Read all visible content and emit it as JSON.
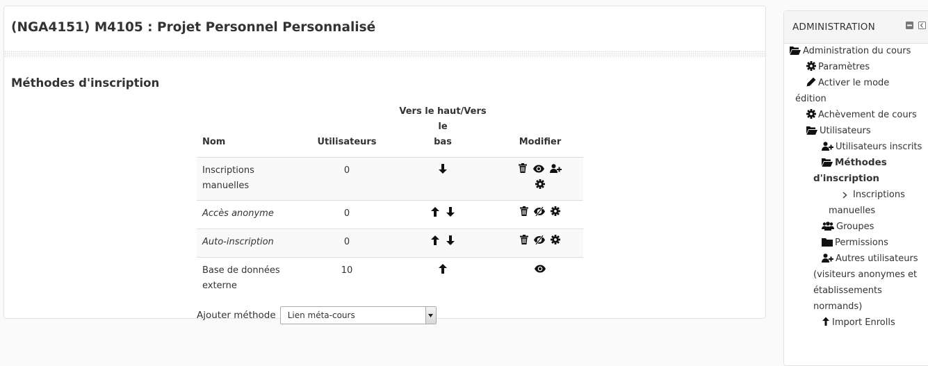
{
  "course": {
    "title": "(NGA4151) M4105 : Projet Personnel Personnalisé"
  },
  "page": {
    "heading": "Méthodes d'inscription"
  },
  "table": {
    "headers": {
      "name": "Nom",
      "users": "Utilisateurs",
      "updown_line1": "Vers le haut/Vers le",
      "updown_line2": "bas",
      "edit": "Modifier"
    },
    "rows": [
      {
        "name_line1": "Inscriptions",
        "name_line2": "manuelles",
        "users": "0",
        "italic": false,
        "up": false,
        "down": true,
        "edit_icons": [
          "trash-icon",
          "eye-icon",
          "user-plus-icon",
          "cog-icon"
        ]
      },
      {
        "name_line1": "Accès anonyme",
        "name_line2": "",
        "users": "0",
        "italic": true,
        "up": true,
        "down": true,
        "edit_icons": [
          "trash-icon",
          "eye-slash-icon",
          "cog-icon"
        ]
      },
      {
        "name_line1": "Auto-inscription",
        "name_line2": "",
        "users": "0",
        "italic": true,
        "up": true,
        "down": true,
        "edit_icons": [
          "trash-icon",
          "eye-slash-icon",
          "cog-icon"
        ]
      },
      {
        "name_line1": "Base de données",
        "name_line2": "externe",
        "users": "10",
        "italic": false,
        "up": true,
        "down": false,
        "edit_icons": [
          "eye-icon"
        ]
      }
    ]
  },
  "add_method": {
    "label": "Ajouter méthode",
    "selected": "Lien méta-cours"
  },
  "sidebar": {
    "title": "ADMINISTRATION",
    "items": {
      "course_admin": "Administration du cours",
      "params": "Paramètres",
      "edit_mode_1": "Activer le mode",
      "edit_mode_2": "édition",
      "completion": "Achèvement de cours",
      "users": "Utilisateurs",
      "enrolled": "Utilisateurs inscrits",
      "methods_1": "Méthodes",
      "methods_2": "d'inscription",
      "manual_1": "Inscriptions",
      "manual_2": "manuelles",
      "groups": "Groupes",
      "permissions": "Permissions",
      "other_1": "Autres utilisateurs",
      "other_2": "(visiteurs anonymes et",
      "other_3": "établissements",
      "other_4": "normands)",
      "import": "Import Enrolls"
    }
  },
  "colors": {
    "text": "#333333",
    "border": "#e3e3e3",
    "stripe": "#f9f9f9"
  }
}
